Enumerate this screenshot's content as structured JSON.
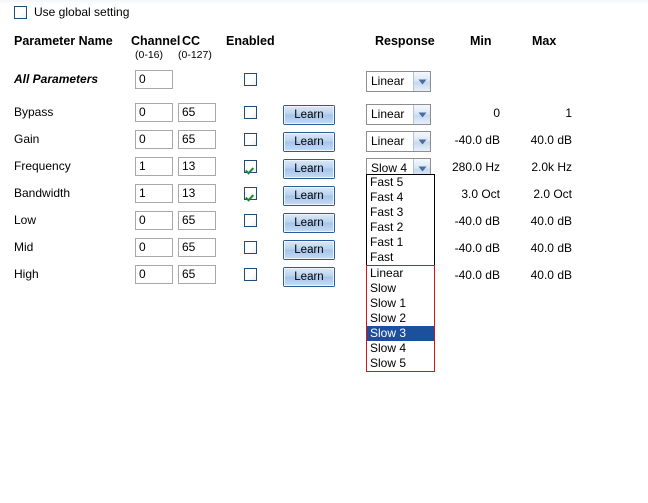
{
  "window": {
    "background": "#ffffff",
    "accent": "#1c4f9c",
    "highlight_border": "#d81313"
  },
  "global_setting": {
    "label": "Use global setting",
    "checked": false
  },
  "headers": {
    "parameter_name": "Parameter Name",
    "channel": "Channel",
    "channel_range": "(0-16)",
    "cc": "CC",
    "cc_range": "(0-127)",
    "enabled": "Enabled",
    "response": "Response",
    "min": "Min",
    "max": "Max"
  },
  "rows": [
    {
      "name": "All Parameters",
      "channel": "0",
      "cc": "",
      "enabled": false,
      "has_cc": false,
      "has_learn": false,
      "response": "Linear",
      "min": "",
      "max": ""
    },
    {
      "name": "Bypass",
      "channel": "0",
      "cc": "65",
      "enabled": false,
      "has_cc": true,
      "has_learn": true,
      "learn_label": "Learn",
      "response": "Linear",
      "min": "0",
      "max": "1"
    },
    {
      "name": "Gain",
      "channel": "0",
      "cc": "65",
      "enabled": false,
      "has_cc": true,
      "has_learn": true,
      "learn_label": "Learn",
      "response": "Linear",
      "min": "-40.0 dB",
      "max": "40.0 dB"
    },
    {
      "name": "Frequency",
      "channel": "1",
      "cc": "13",
      "enabled": true,
      "has_cc": true,
      "has_learn": true,
      "learn_label": "Learn",
      "response": "Slow 4",
      "min": "280.0 Hz",
      "max": "2.0k Hz"
    },
    {
      "name": "Bandwidth",
      "channel": "1",
      "cc": "13",
      "enabled": true,
      "has_cc": true,
      "has_learn": true,
      "learn_label": "Learn",
      "response": "",
      "min": "3.0 Oct",
      "max": "2.0 Oct"
    },
    {
      "name": "Low",
      "channel": "0",
      "cc": "65",
      "enabled": false,
      "has_cc": true,
      "has_learn": true,
      "learn_label": "Learn",
      "response": "",
      "min": "-40.0 dB",
      "max": "40.0 dB"
    },
    {
      "name": "Mid",
      "channel": "0",
      "cc": "65",
      "enabled": false,
      "has_cc": true,
      "has_learn": true,
      "learn_label": "Learn",
      "response": "",
      "min": "-40.0 dB",
      "max": "40.0 dB"
    },
    {
      "name": "High",
      "channel": "0",
      "cc": "65",
      "enabled": false,
      "has_cc": true,
      "has_learn": true,
      "learn_label": "Learn",
      "response": "",
      "min": "-40.0 dB",
      "max": "40.0 dB"
    }
  ],
  "response_dropdown": {
    "open": true,
    "owner_row": "Frequency",
    "current_value": "Slow 4",
    "selected_option": "Slow 3",
    "group_1": [
      "Fast 5",
      "Fast 4",
      "Fast 3",
      "Fast 2",
      "Fast 1",
      "Fast"
    ],
    "group_2": [
      "Linear",
      "Slow",
      "Slow 1",
      "Slow 2",
      "Slow 3",
      "Slow 4",
      "Slow 5"
    ]
  },
  "icons": {
    "chevron_down": "chevron-down-icon",
    "checkmark": "checkmark-icon"
  }
}
